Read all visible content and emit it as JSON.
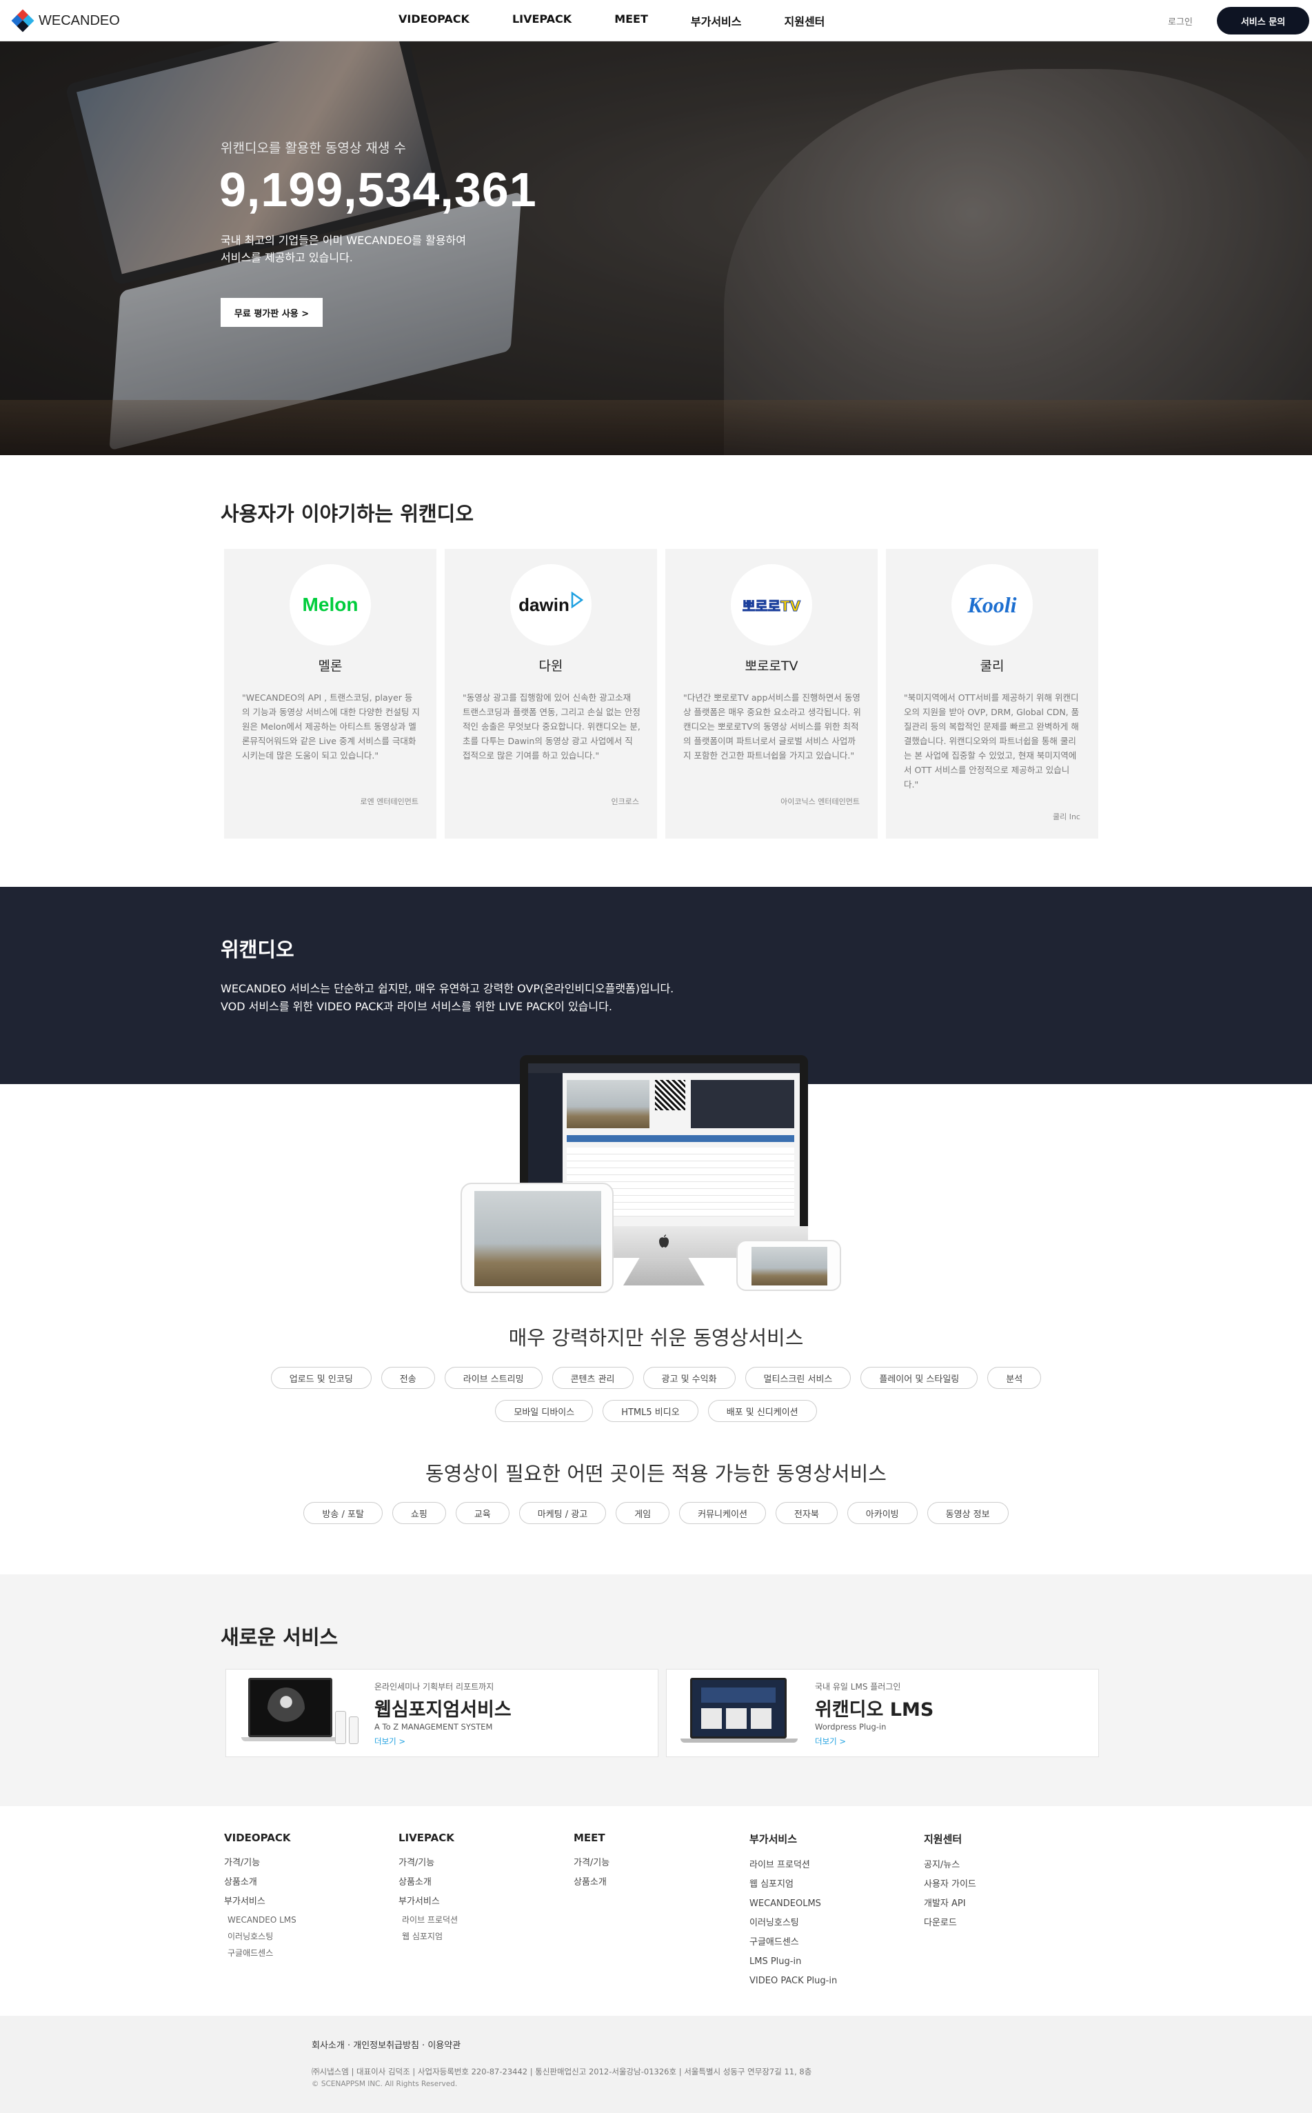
{
  "header": {
    "logo_text": "WECANDEO",
    "nav": [
      "VIDEOPACK",
      "LIVEPACK",
      "MEET",
      "부가서비스",
      "지원센터"
    ],
    "login": "로그인",
    "contact": "서비스 문의"
  },
  "hero": {
    "subtitle": "위캔디오를 활용한 동영상 재생 수",
    "count": "9,199,534,361",
    "desc_line1": "국내 최고의 기업들은 이미 WECANDEO를 활용하여",
    "desc_line2": "서비스를 제공하고 있습니다.",
    "button": "무료 평가판 사용 >"
  },
  "testimonials": {
    "title": "사용자가 이야기하는 위캔디오",
    "cards": [
      {
        "logo": "Melon",
        "name": "멜론",
        "quote": "\"WECANDEO의 API , 트랜스코딩, player 등의 기능과 동영상 서비스에 대한 다양한 컨설팅 지원은 Melon에서 제공하는 아티스트 동영상과 멜론뮤직어워드와 같은 Live 중계 서비스를 극대화 시키는데 많은 도움이 되고 있습니다.\"",
        "author": "로엔 엔터테인먼트"
      },
      {
        "logo": "dawin",
        "name": "다윈",
        "quote": "\"동영상 광고를 집행함에 있어 신속한 광고소재 트랜스코딩과 플랫폼 연동, 그리고 손실 없는 안정적인 송출은 무엇보다 중요합니다. 위캔디오는 분, 초를 다투는 Dawin의 동영상 광고 사업에서 직접적으로 많은 기여를 하고 있습니다.\"",
        "author": "인크로스"
      },
      {
        "logo": "뽀로로TV",
        "name": "뽀로로TV",
        "quote": "\"다년간 뽀로로TV app서비스를 진행하면서 동영상 플랫폼은 매우 중요한 요소라고 생각됩니다. 위캔디오는 뽀로로TV의 동영상 서비스를 위한 최적의 플랫폼이며 파트너로서 글로벌 서비스 사업까지 포함한 건고한 파트너쉽을 가지고 있습니다.\"",
        "author": "아이코닉스 엔터테인먼트"
      },
      {
        "logo": "Kooli",
        "name": "쿨리",
        "quote": "\"북미지역에서 OTT서비를 제공하기 위해 위캔디오의 지원을 받아 OVP, DRM, Global CDN, 품질관리 등의 복합적인 문제를 빠르고 완벽하게 해결했습니다. 위캔디오와의 파트너쉽을 통해 쿨리는 본 사업에 집중할 수 있었고, 현재 북미지역에서 OTT 서비스를 안정적으로 제공하고 있습니다.\"",
        "author": "쿨리 Inc"
      }
    ]
  },
  "wecandeo": {
    "title": "위캔디오",
    "desc_line1": "WECANDEO 서비스는 단순하고 쉽지만, 매우 유연하고 강력한 OVP(온라인비디오플랫폼)입니다.",
    "desc_line2": "VOD 서비스를 위한 VIDEO PACK과 라이브 서비스를 위한 LIVE PACK이 있습니다."
  },
  "features": {
    "title": "매우 강력하지만 쉬운 동영상서비스",
    "row1": [
      "업로드 및 인코딩",
      "전송",
      "라이브 스트리밍",
      "콘텐츠 관리",
      "광고 및 수익화",
      "멀티스크린 서비스",
      "플레이어 및 스타일링",
      "분석"
    ],
    "row2": [
      "모바일 디바이스",
      "HTML5 비디오",
      "배포 및 신디케이션"
    ]
  },
  "usecases": {
    "title": "동영상이 필요한 어떤 곳이든 적용 가능한 동영상서비스",
    "chips": [
      "방송 / 포탈",
      "쇼핑",
      "교육",
      "마케팅 / 광고",
      "게임",
      "커뮤니케이션",
      "전자북",
      "아카이빙",
      "동영상 정보"
    ]
  },
  "new_services": {
    "title": "새로운 서비스",
    "cards": [
      {
        "small": "온라인세미나 기획부터 리포트까지",
        "title": "웹심포지엄서비스",
        "sub": "A To Z MANAGEMENT SYSTEM",
        "more": "더보기 >"
      },
      {
        "small": "국내 유일 LMS 플러그인",
        "title": "위캔디오 LMS",
        "sub": "Wordpress Plug-in",
        "more": "더보기 >"
      }
    ]
  },
  "footer": {
    "columns": [
      {
        "title": "VIDEOPACK",
        "links": [
          "가격/기능",
          "상품소개",
          "부가서비스"
        ],
        "sublinks": [
          "WECANDEO LMS",
          "이러닝호스팅",
          "구글애드센스"
        ]
      },
      {
        "title": "LIVEPACK",
        "links": [
          "가격/기능",
          "상품소개",
          "부가서비스"
        ],
        "sublinks": [
          "라이브 프로덕션",
          "웹 심포지엄"
        ]
      },
      {
        "title": "MEET",
        "links": [
          "가격/기능",
          "상품소개"
        ],
        "sublinks": []
      },
      {
        "title": "부가서비스",
        "links": [
          "라이브 프로덕션",
          "웹 심포지엄",
          "WECANDEOLMS",
          "이러닝호스팅",
          "구글애드센스",
          "LMS Plug-in",
          "VIDEO PACK Plug-in"
        ],
        "sublinks": []
      },
      {
        "title": "지원센터",
        "links": [
          "공지/뉴스",
          "사용자 가이드",
          "개발자 API",
          "다운로드"
        ],
        "sublinks": []
      }
    ],
    "bottom_links": "회사소개 · 개인정보취급방침 · 이용약관",
    "info": "㈜시냅스엠 | 대표이사 김덕조 | 사업자등록번호 220-87-23442 | 통신판매업신고 2012-서울강남-01326호 | 서울특별시 성동구 연무장7길 11, 8층",
    "copyright": "© SCENAPPSM INC. All Rights Reserved."
  },
  "colors": {
    "dark_band": "#1f2433",
    "button_dark": "#0e1423",
    "melon_green": "#00cd3c",
    "link_blue": "#1ea0e0"
  }
}
